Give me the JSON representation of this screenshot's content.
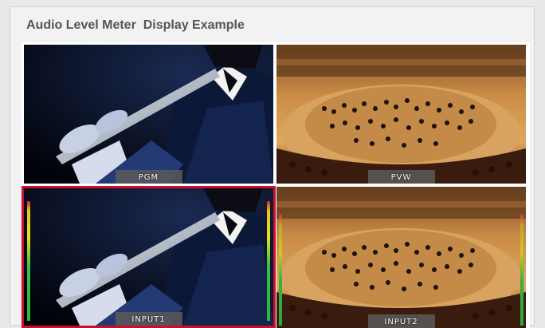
{
  "title": "Audio Level Meter  Display Example",
  "tiles": {
    "pgm": {
      "label": "PGM",
      "scene": "flute-player"
    },
    "pvw": {
      "label": "PVW",
      "scene": "orchestra-hall"
    },
    "input1": {
      "label": "INPUT1",
      "scene": "flute-player",
      "selected": true,
      "border_color": "#c8102e"
    },
    "input2": {
      "label": "INPUT2",
      "scene": "orchestra-hall"
    }
  },
  "audio_meters": {
    "input1": {
      "left_level": 0.95,
      "right_level": 0.95
    },
    "input2": {
      "left_level": 0.95,
      "right_level": 0.95
    }
  },
  "colors": {
    "background": "#e9e9e9",
    "title": "#555555",
    "selected_border": "#c8102e",
    "meter_red": "#d92020",
    "meter_yellow": "#e9e21c",
    "meter_green": "#2bb53a"
  }
}
